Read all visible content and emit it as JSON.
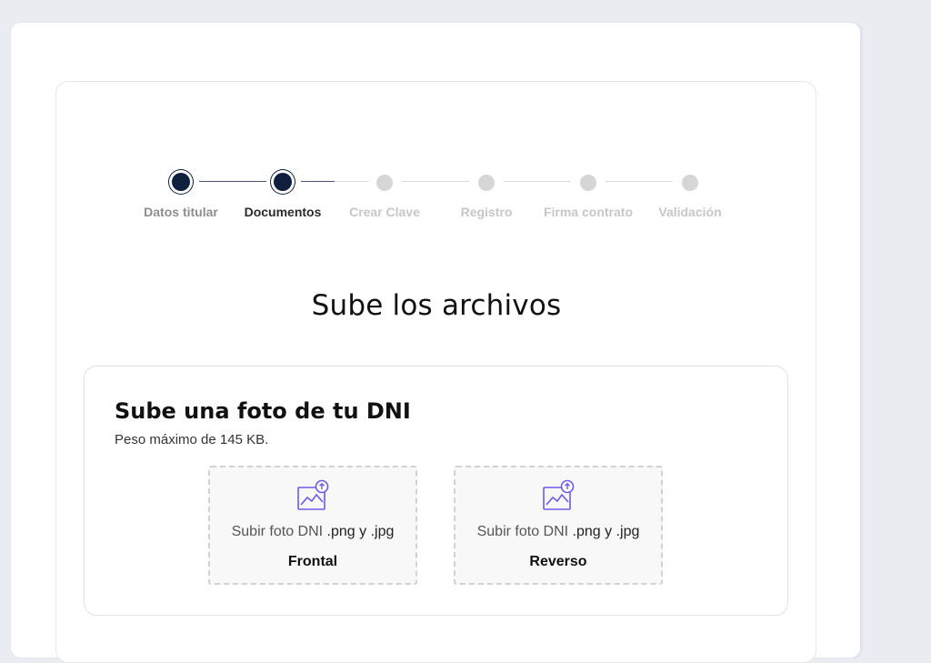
{
  "stepper": {
    "steps": [
      {
        "label": "Datos titular",
        "state": "done"
      },
      {
        "label": "Documentos",
        "state": "current"
      },
      {
        "label": "Crear Clave",
        "state": "pending"
      },
      {
        "label": "Registro",
        "state": "pending"
      },
      {
        "label": "Firma contrato",
        "state": "pending"
      },
      {
        "label": "Validación",
        "state": "pending"
      }
    ]
  },
  "main": {
    "title": "Sube los archivos"
  },
  "upload": {
    "heading": "Sube una foto de tu DNI",
    "subtitle": "Peso máximo de 145 KB.",
    "front": {
      "text": "Subir foto DNI",
      "ext": ".png y .jpg",
      "side": "Frontal",
      "icon": "image-upload-icon"
    },
    "back": {
      "text": "Subir foto DNI",
      "ext": ".png y .jpg",
      "side": "Reverso",
      "icon": "image-upload-icon"
    }
  },
  "colors": {
    "accent": "#0f1f3d",
    "icon": "#6b5ce7"
  }
}
